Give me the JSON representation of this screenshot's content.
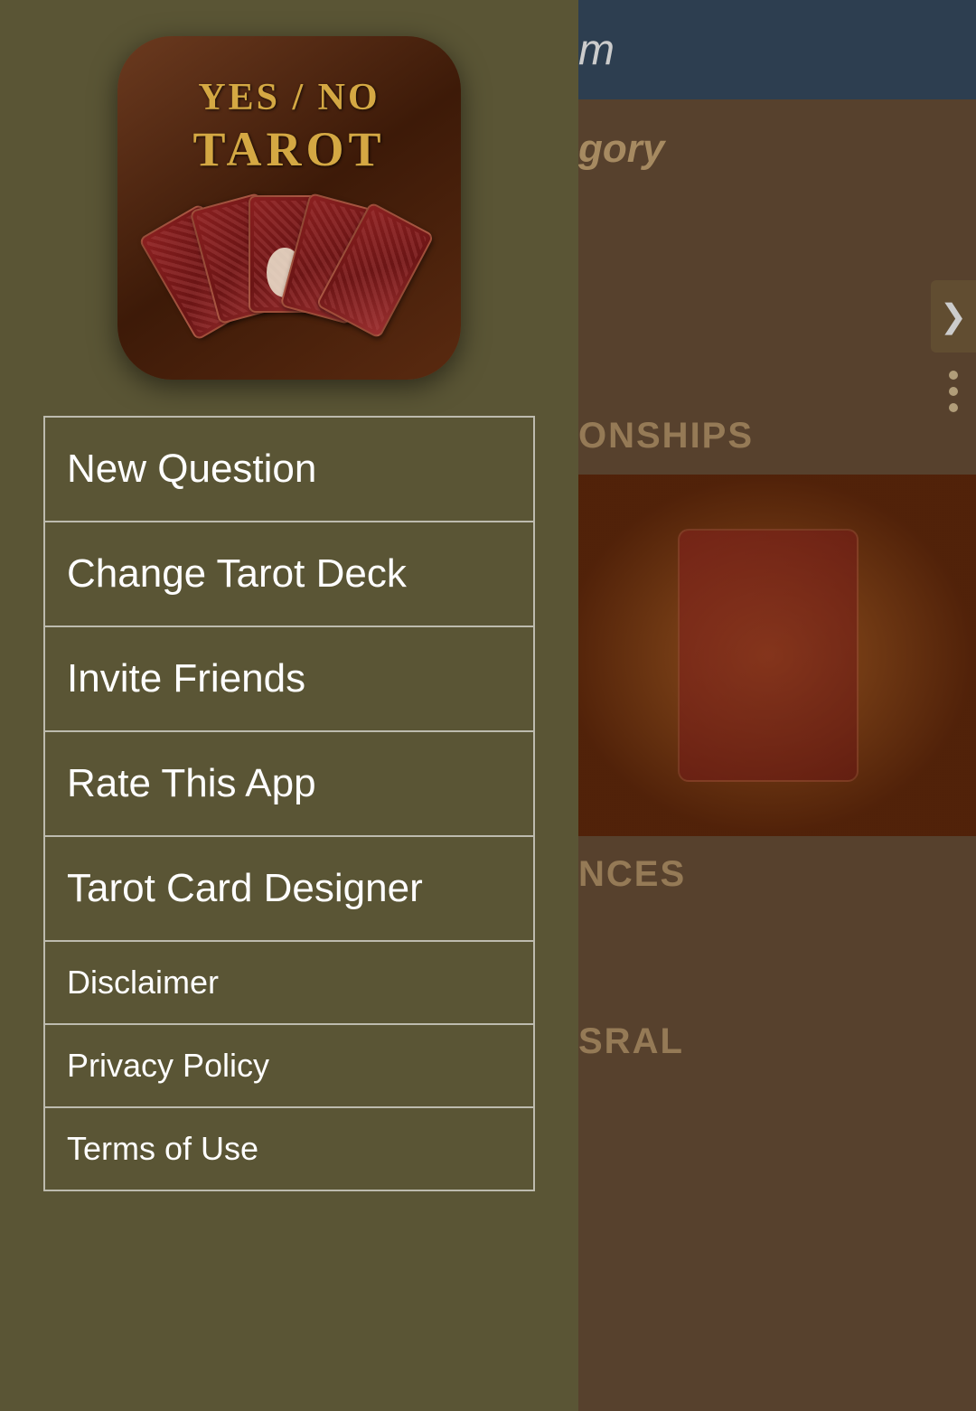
{
  "app": {
    "title": "YES / NO TAROT"
  },
  "logo": {
    "line1": "YES / NO",
    "line2": "TAROT"
  },
  "right_panel": {
    "header_text": "m",
    "category_text": "gory",
    "section1": "ONSHIPS",
    "section2": "NCES",
    "section3": "SRAL"
  },
  "menu": {
    "items": [
      {
        "id": "new-question",
        "label": "New Question",
        "size": "large"
      },
      {
        "id": "change-tarot-deck",
        "label": "Change Tarot Deck",
        "size": "large"
      },
      {
        "id": "invite-friends",
        "label": "Invite Friends",
        "size": "large"
      },
      {
        "id": "rate-this-app",
        "label": "Rate This App",
        "size": "large"
      },
      {
        "id": "tarot-card-designer",
        "label": "Tarot Card Designer",
        "size": "large"
      },
      {
        "id": "disclaimer",
        "label": "Disclaimer",
        "size": "small"
      },
      {
        "id": "privacy-policy",
        "label": "Privacy Policy",
        "size": "small"
      },
      {
        "id": "terms-of-use",
        "label": "Terms of Use",
        "size": "small"
      }
    ]
  }
}
